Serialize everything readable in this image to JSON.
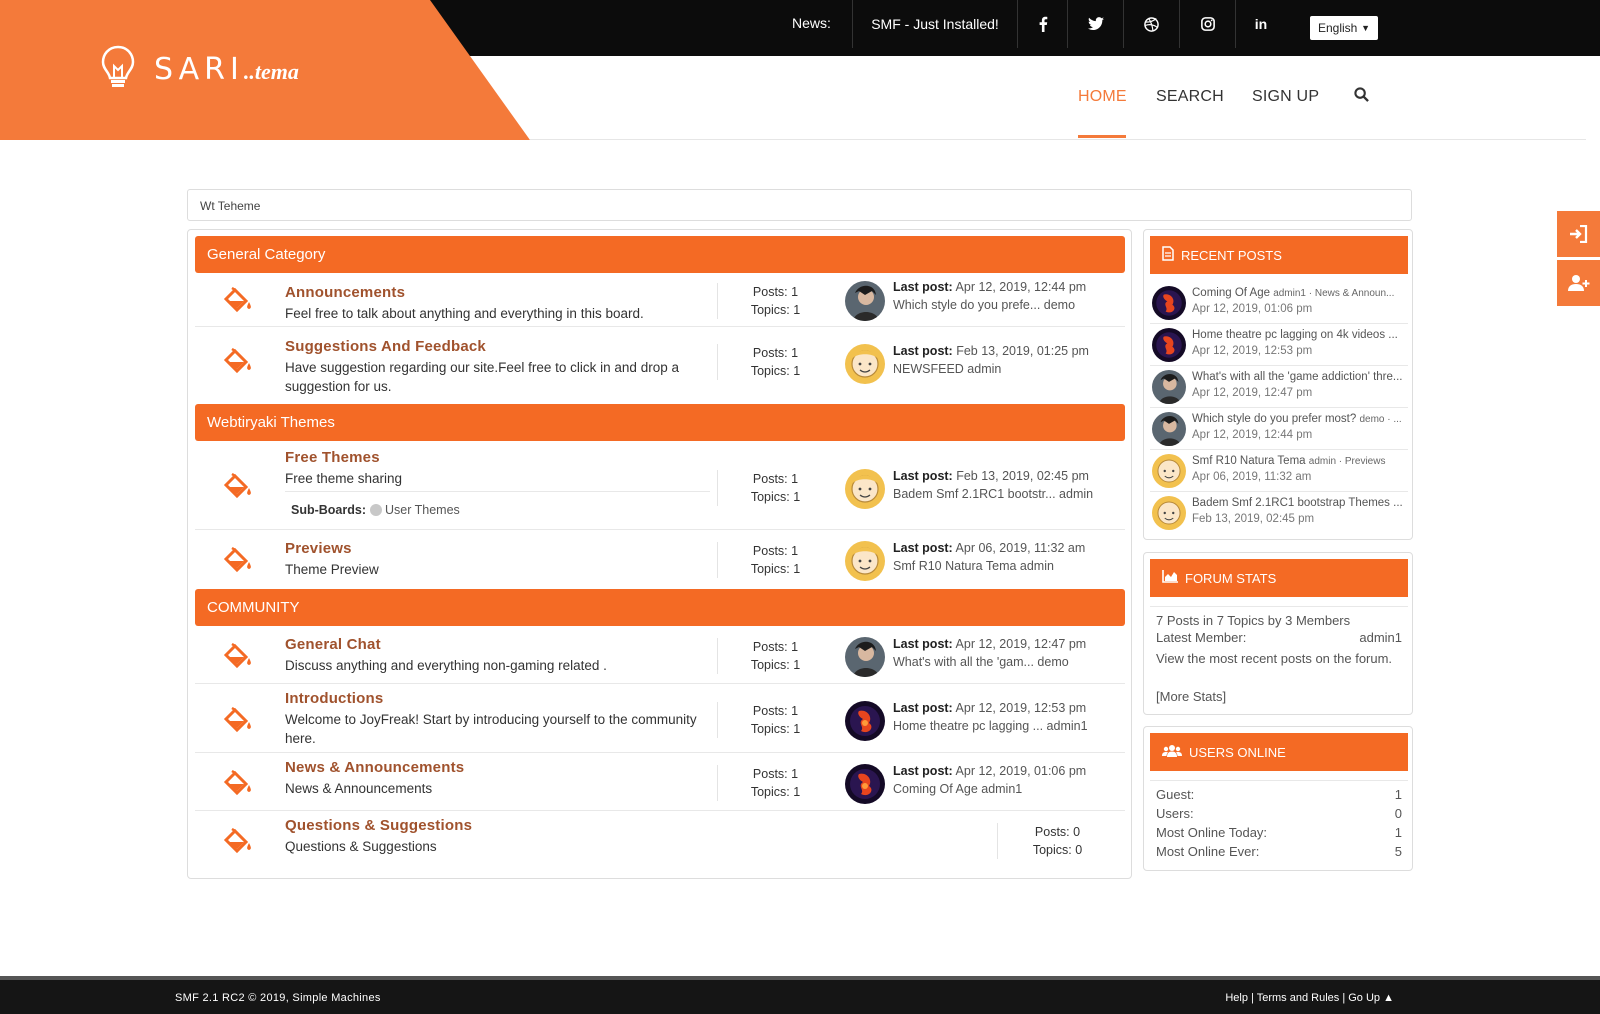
{
  "header": {
    "logo_text": "SARI",
    "logo_sub": "..tema",
    "news_label": "News:",
    "news_item": "SMF - Just Installed!",
    "social": [
      "facebook-icon",
      "twitter-icon",
      "dribbble-icon",
      "instagram-icon",
      "linkedin-icon"
    ],
    "linkedin_label": "in",
    "language": "English",
    "nav": {
      "home": "HOME",
      "search": "SEARCH",
      "signup": "SIGN UP"
    },
    "accent_color": "#f47a3a"
  },
  "breadcrumb": "Wt Teheme",
  "categories": [
    {
      "name": "General Category"
    },
    {
      "name": "Webtiryaki Themes"
    },
    {
      "name": "COMMUNITY"
    }
  ],
  "boards": [
    {
      "title": "Announcements",
      "desc": "Feel free to talk about anything and everything in this board.",
      "posts": "Posts: 1",
      "topics": "Topics: 1",
      "last_label": "Last post:",
      "last_date": "Apr 12, 2019, 12:44 pm",
      "last_info": "Which style do you prefe... demo"
    },
    {
      "title": "Suggestions And Feedback",
      "desc": "Have  suggestion regarding our site.Feel free to click in and drop a suggestion for us.",
      "posts": "Posts: 1",
      "topics": "Topics: 1",
      "last_label": "Last post:",
      "last_date": "Feb 13, 2019, 01:25 pm",
      "last_info": "NEWSFEED admin"
    },
    {
      "title": "Free Themes",
      "desc": "Free theme sharing",
      "posts": "Posts: 1",
      "topics": "Topics: 1",
      "last_label": "Last post:",
      "last_date": "Feb 13, 2019, 02:45 pm",
      "last_info": "Badem Smf 2.1RC1 bootstr... admin",
      "sub_label": "Sub-Boards:",
      "sub_board": "User Themes"
    },
    {
      "title": "Previews",
      "desc": "Theme Preview",
      "posts": "Posts: 1",
      "topics": "Topics: 1",
      "last_label": "Last post:",
      "last_date": "Apr 06, 2019, 11:32 am",
      "last_info": "Smf R10 Natura Tema admin"
    },
    {
      "title": "General Chat",
      "desc": "Discuss anything and everything non-gaming related .",
      "posts": "Posts: 1",
      "topics": "Topics: 1",
      "last_label": "Last post:",
      "last_date": "Apr 12, 2019, 12:47 pm",
      "last_info": "What's with all the 'gam... demo"
    },
    {
      "title": "Introductions",
      "desc": "Welcome to JoyFreak! Start by introducing yourself to the community here.",
      "posts": "Posts: 1",
      "topics": "Topics: 1",
      "last_label": "Last post:",
      "last_date": "Apr 12, 2019, 12:53 pm",
      "last_info": "Home theatre pc lagging ... admin1"
    },
    {
      "title": "News & Announcements",
      "desc": "News & Announcements",
      "posts": "Posts: 1",
      "topics": "Topics: 1",
      "last_label": "Last post:",
      "last_date": "Apr 12, 2019, 01:06 pm",
      "last_info": "Coming Of Age admin1"
    },
    {
      "title": "Questions & Suggestions",
      "desc": "Questions & Suggestions",
      "posts": "Posts: 0",
      "topics": "Topics: 0"
    }
  ],
  "recent_posts": {
    "title": "RECENT POSTS",
    "items": [
      {
        "subject": "Coming Of Age",
        "meta": "admin1 · News & Announ...",
        "date": "Apr 12, 2019, 01:06 pm"
      },
      {
        "subject": "Home theatre pc lagging on 4k videos ...",
        "meta": "",
        "date": "Apr 12, 2019, 12:53 pm"
      },
      {
        "subject": "What's with all the 'game addiction' thre...",
        "meta": "",
        "date": "Apr 12, 2019, 12:47 pm"
      },
      {
        "subject": "Which style do you prefer most?",
        "meta": "demo · ...",
        "date": "Apr 12, 2019, 12:44 pm"
      },
      {
        "subject": "Smf R10 Natura Tema",
        "meta": "admin · Previews",
        "date": "Apr 06, 2019, 11:32 am"
      },
      {
        "subject": "Badem Smf 2.1RC1 bootstrap Themes ...",
        "meta": "",
        "date": "Feb 13, 2019, 02:45 pm"
      }
    ]
  },
  "forum_stats": {
    "title": "FORUM STATS",
    "summary": "7 Posts in 7 Topics by 3 Members",
    "latest_label": "Latest Member:",
    "latest_value": "admin1",
    "recent_link": "View the most recent posts on the forum.",
    "more_link": "[More Stats]"
  },
  "users_online": {
    "title": "USERS ONLINE",
    "rows": [
      {
        "label": "Guest:",
        "value": "1"
      },
      {
        "label": "Users:",
        "value": "0"
      },
      {
        "label": "Most Online Today:",
        "value": "1"
      },
      {
        "label": "Most Online Ever:",
        "value": "5"
      }
    ]
  },
  "footer": {
    "copyright": "SMF 2.1 RC2 © 2019, Simple Machines",
    "help": "Help",
    "terms": "Terms and Rules",
    "goup": "Go Up ▲",
    "sep": "|"
  }
}
